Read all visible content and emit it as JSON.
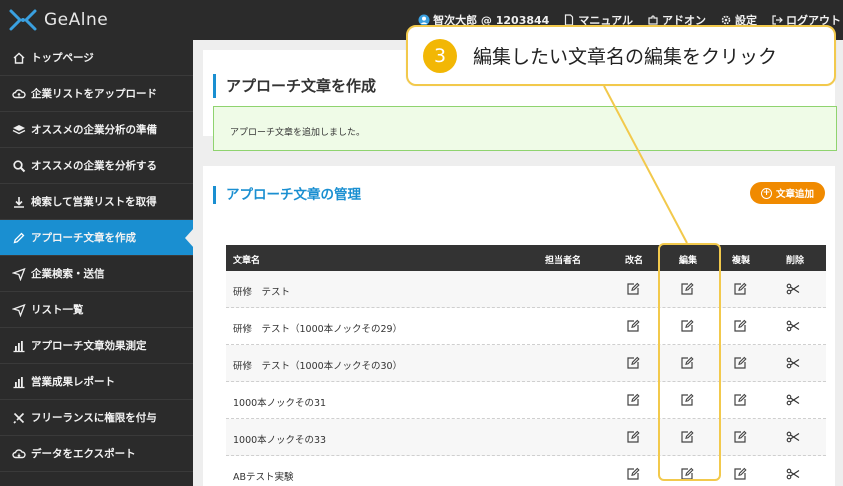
{
  "header": {
    "logo_text": "GeAlne",
    "user": "智次大郎 @ 1203844",
    "manual": "マニュアル",
    "addon": "アドオン",
    "settings": "設定",
    "logout": "ログアウト"
  },
  "sidebar": {
    "items": [
      {
        "label": "トップページ",
        "icon": "home-icon"
      },
      {
        "label": "企業リストをアップロード",
        "icon": "cloud-upload-icon"
      },
      {
        "label": "オススメの企業分析の準備",
        "icon": "layers-icon"
      },
      {
        "label": "オススメの企業を分析する",
        "icon": "search-icon"
      },
      {
        "label": "検索して営業リストを取得",
        "icon": "download-icon"
      },
      {
        "label": "アプローチ文章を作成",
        "icon": "pencil-icon"
      },
      {
        "label": "企業検索・送信",
        "icon": "send-icon"
      },
      {
        "label": "リスト一覧",
        "icon": "send-icon"
      },
      {
        "label": "アプローチ文章効果測定",
        "icon": "bar-chart-icon"
      },
      {
        "label": "営業成果レポート",
        "icon": "bar-chart-icon"
      },
      {
        "label": "フリーランスに権限を付与",
        "icon": "tools-icon"
      },
      {
        "label": "データをエクスポート",
        "icon": "cloud-download-icon"
      }
    ],
    "active_index": 5
  },
  "main": {
    "page_title": "アプローチ文章を作成",
    "alert": "アプローチ文章を追加しました。",
    "section_title": "アプローチ文章の管理",
    "add_button": "文章追加",
    "table": {
      "columns": [
        "文章名",
        "担当者名",
        "改名",
        "編集",
        "複製",
        "削除"
      ],
      "rows": [
        "研修　テスト",
        "研修　テスト（1000本ノックその29）",
        "研修　テスト（1000本ノックその30）",
        "1000本ノックその31",
        "1000本ノックその33",
        "ABテスト実験"
      ]
    }
  },
  "callout": {
    "step": "3",
    "text": "編集したい文章名の編集をクリック"
  },
  "colors": {
    "accent": "#1a8fd1",
    "highlight": "#f2c94c",
    "step_badge": "#f2b705",
    "add_button": "#f08a00"
  }
}
